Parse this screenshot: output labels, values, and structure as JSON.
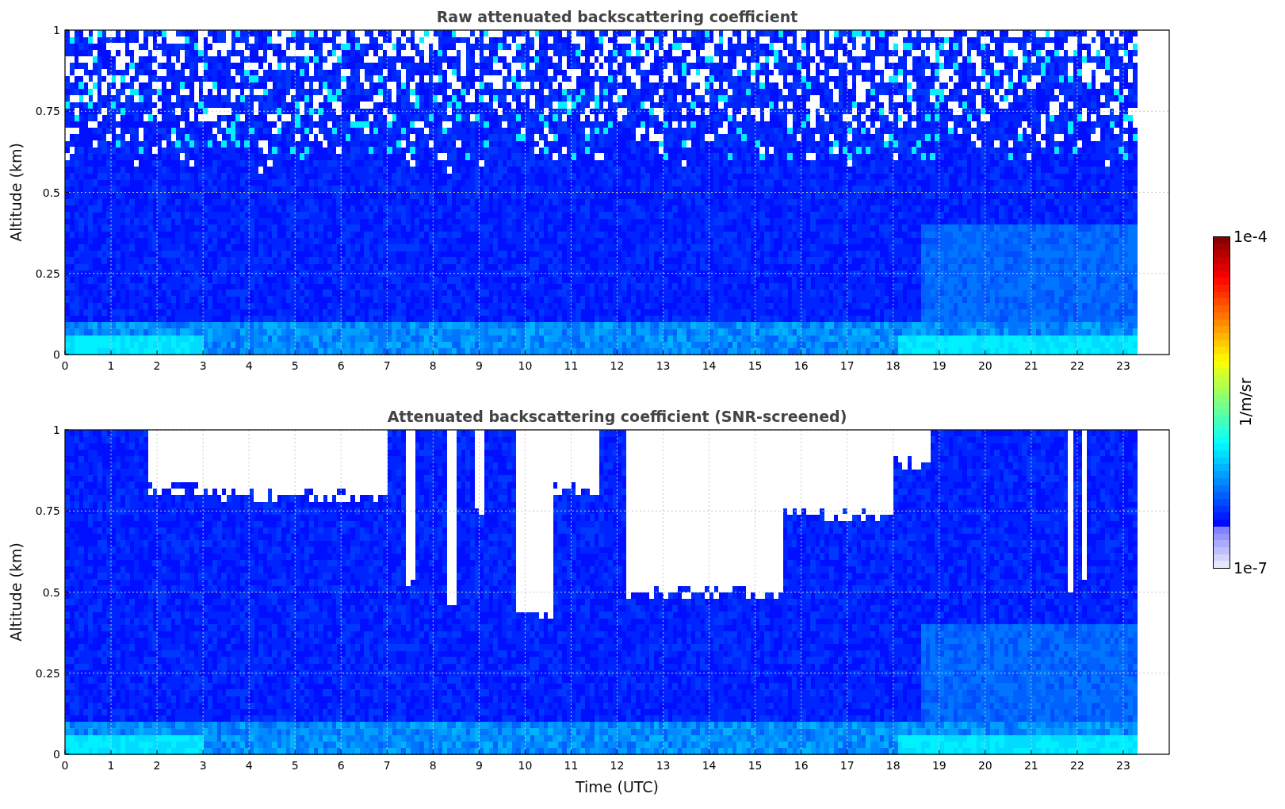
{
  "panels": [
    {
      "title": "Raw attenuated backscattering coefficient",
      "ylabel": "Altitude (km)",
      "screened": false,
      "yticks": [
        "1",
        "0.75",
        "0.5",
        "0.25",
        "0"
      ],
      "xticks": [
        "0",
        "1",
        "2",
        "3",
        "4",
        "5",
        "6",
        "7",
        "8",
        "9",
        "10",
        "11",
        "12",
        "13",
        "14",
        "15",
        "16",
        "17",
        "18",
        "19",
        "20",
        "21",
        "22",
        "23"
      ]
    },
    {
      "title": "Attenuated backscattering coefficient (SNR-screened)",
      "ylabel": "Altitude (km)",
      "xlabel": "Time (UTC)",
      "screened": true,
      "yticks": [
        "1",
        "0.75",
        "0.5",
        "0.25",
        "0"
      ],
      "xticks": [
        "0",
        "1",
        "2",
        "3",
        "4",
        "5",
        "6",
        "7",
        "8",
        "9",
        "10",
        "11",
        "12",
        "13",
        "14",
        "15",
        "16",
        "17",
        "18",
        "19",
        "20",
        "21",
        "22",
        "23"
      ]
    }
  ],
  "colorbar": {
    "label": "1/m/sr",
    "max_label": "1e-4",
    "min_label": "1e-7"
  }
}
